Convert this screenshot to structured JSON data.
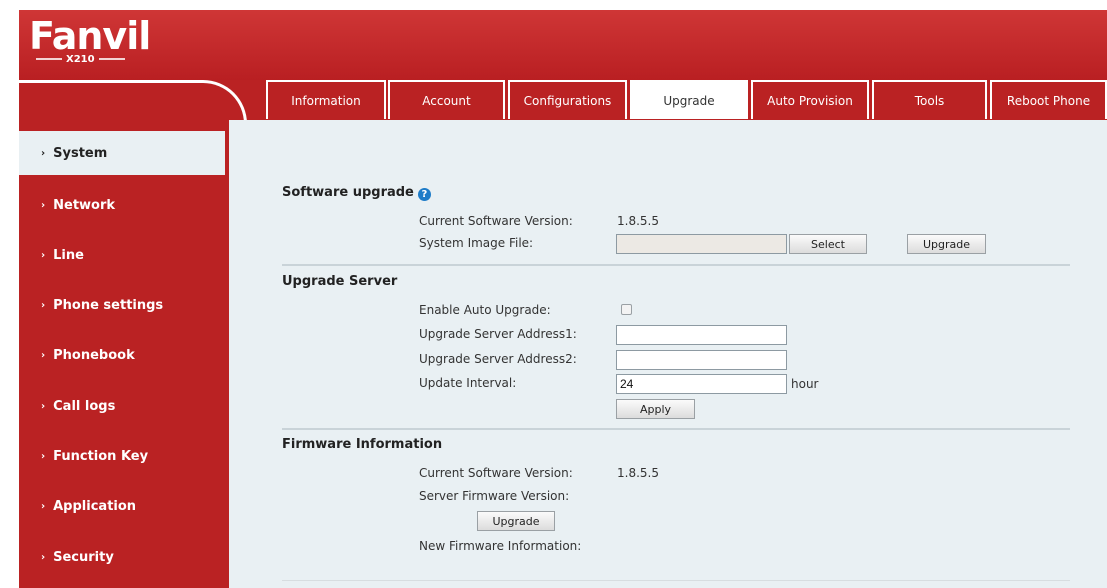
{
  "header": {
    "logo_text": "Fanvil",
    "model": "X210"
  },
  "tabs": [
    {
      "label": "Information"
    },
    {
      "label": "Account"
    },
    {
      "label": "Configurations"
    },
    {
      "label": "Upgrade"
    },
    {
      "label": "Auto Provision"
    },
    {
      "label": "Tools"
    },
    {
      "label": "Reboot Phone"
    }
  ],
  "sidebar": {
    "items": [
      {
        "label": "System"
      },
      {
        "label": "Network"
      },
      {
        "label": "Line"
      },
      {
        "label": "Phone settings"
      },
      {
        "label": "Phonebook"
      },
      {
        "label": "Call logs"
      },
      {
        "label": "Function Key"
      },
      {
        "label": "Application"
      },
      {
        "label": "Security"
      }
    ]
  },
  "software_upgrade": {
    "title": "Software upgrade",
    "current_version_label": "Current Software Version:",
    "current_version_value": "1.8.5.5",
    "image_file_label": "System Image File:",
    "image_file_value": "",
    "select_button": "Select",
    "upgrade_button": "Upgrade"
  },
  "upgrade_server": {
    "title": "Upgrade Server",
    "enable_auto_label": "Enable Auto Upgrade:",
    "address1_label": "Upgrade Server Address1:",
    "address1_value": "",
    "address2_label": "Upgrade Server Address2:",
    "address2_value": "",
    "interval_label": "Update Interval:",
    "interval_value": "24",
    "interval_unit": "hour",
    "apply_button": "Apply"
  },
  "firmware_info": {
    "title": "Firmware Information",
    "current_version_label": "Current Software Version:",
    "current_version_value": "1.8.5.5",
    "server_version_label": "Server Firmware Version:",
    "upgrade_button": "Upgrade",
    "new_info_label": "New Firmware Information:"
  }
}
